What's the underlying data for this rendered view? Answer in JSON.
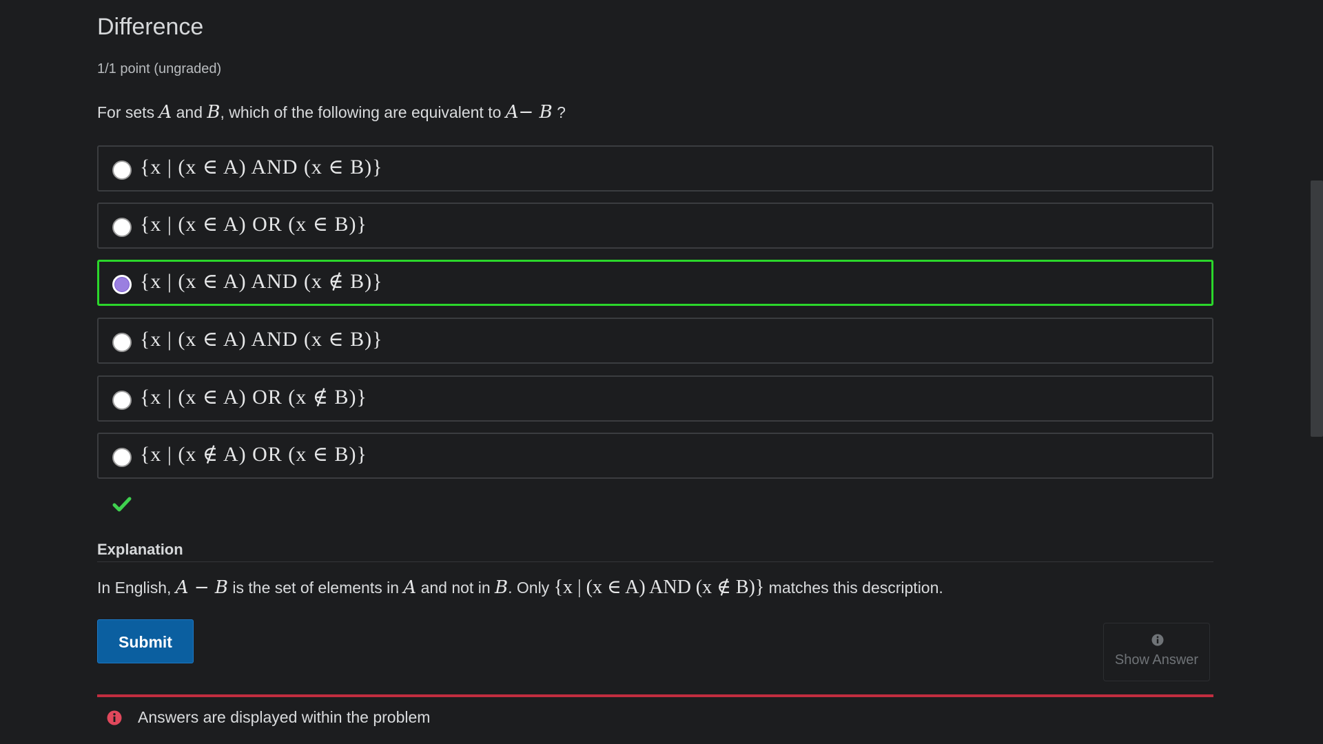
{
  "problem": {
    "title": "Difference",
    "points": "1/1 point (ungraded)",
    "prompt_prefix": "For sets ",
    "prompt_var_a": "A",
    "prompt_and": " and ",
    "prompt_var_b": "B",
    "prompt_middle": ", which of the following are equivalent to ",
    "prompt_expr": "A− B",
    "prompt_suffix": " ?"
  },
  "options": [
    {
      "label": "{x | (x ∈ A)  AND  (x ∈ B)}",
      "selected": false
    },
    {
      "label": "{x | (x ∈ A)  OR  (x ∈ B)}",
      "selected": false
    },
    {
      "label": "{x | (x ∈ A)  AND  (x ∉ B)}",
      "selected": true
    },
    {
      "label": "{x | (x ∈ A)  AND  (x ∈ B)}",
      "selected": false
    },
    {
      "label": "{x | (x ∈ A)  OR  (x ∉ B)}",
      "selected": false
    },
    {
      "label": "{x | (x ∉ A)  OR  (x ∈ B)}",
      "selected": false
    }
  ],
  "result": {
    "icon": "checkmark-icon",
    "color": "#3fd14f"
  },
  "explanation": {
    "title": "Explanation",
    "text_prefix": "In English, ",
    "expr": "A − B",
    "text_middle1": " is the set of elements in ",
    "var_a": "A",
    "text_middle2": " and not in ",
    "var_b": "B",
    "text_middle3": ". Only ",
    "set_expr": "{x | (x ∈ A)  AND  (x ∉ B)}",
    "text_suffix": " matches this description."
  },
  "actions": {
    "submit_label": "Submit",
    "show_answer_label": "Show Answer",
    "show_answer_icon": "info-icon"
  },
  "notice": {
    "text": "Answers are displayed within the problem",
    "icon": "alert-info-icon",
    "bar_color": "#c12d3f"
  },
  "colors": {
    "background": "#1c1d1f",
    "selected_border": "#2bd62b",
    "submit_bg": "#0b5fa0",
    "radio_checked": "#9a7fe0"
  }
}
